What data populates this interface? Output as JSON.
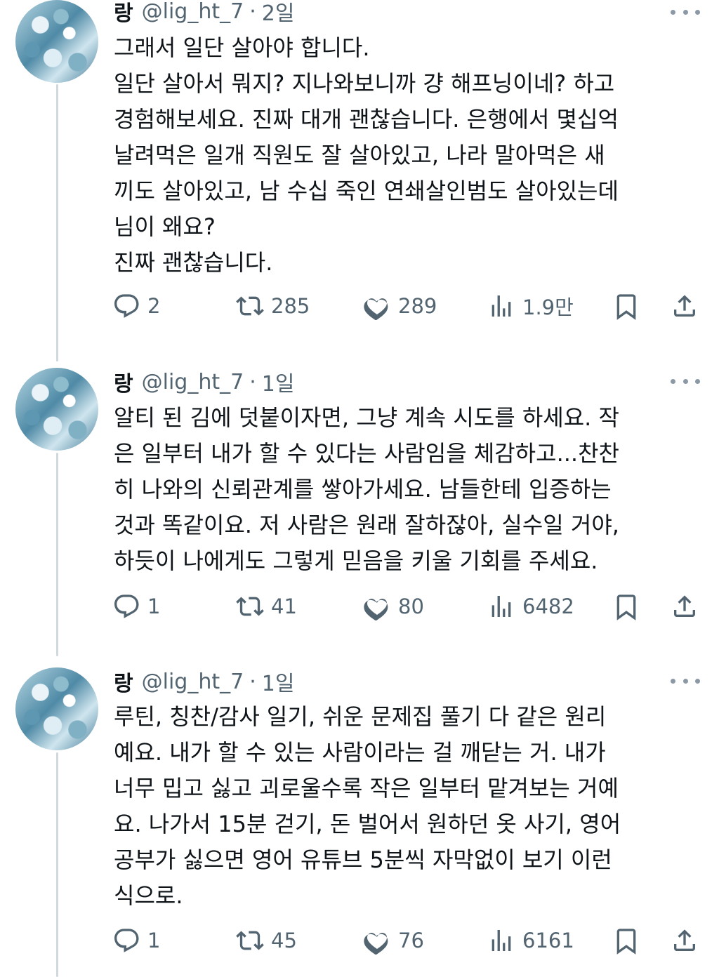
{
  "tweets": [
    {
      "name": "랑",
      "handle": "@lig_ht_7",
      "separator": "·",
      "time": "2일",
      "lines": [
        "그래서 일단 살아야 합니다.",
        "일단 살아서 뭐지? 지나와보니까 걍 해프닝이네? 하고",
        "경험해보세요. 진짜 대개 괜찮습니다. 은행에서 몇십억",
        "날려먹은 일개 직원도 잘 살아있고, 나라 말아먹은 새",
        "끼도 살아있고, 남 수십 죽인 연쇄살인범도 살아있는데",
        "님이 왜요?",
        "진짜 괜찮습니다."
      ],
      "replies": "2",
      "retweets": "285",
      "likes": "289",
      "views": "1.9만"
    },
    {
      "name": "랑",
      "handle": "@lig_ht_7",
      "separator": "·",
      "time": "1일",
      "lines": [
        "알티 된 김에 덧붙이자면, 그냥 계속 시도를 하세요. 작",
        "은 일부터 내가 할 수 있다는 사람임을 체감하고...찬찬",
        "히 나와의 신뢰관계를 쌓아가세요. 남들한테 입증하는",
        "것과 똑같이요. 저 사람은 원래 잘하잖아, 실수일 거야,",
        "하듯이 나에게도 그렇게 믿음을 키울 기회를 주세요."
      ],
      "replies": "1",
      "retweets": "41",
      "likes": "80",
      "views": "6482"
    },
    {
      "name": "랑",
      "handle": "@lig_ht_7",
      "separator": "·",
      "time": "1일",
      "lines": [
        "루틴, 칭찬/감사 일기, 쉬운 문제집 풀기 다 같은 원리",
        "예요. 내가 할 수 있는 사람이라는 걸 깨닫는 거. 내가",
        "너무 밉고 싫고 괴로울수록 작은 일부터 맡겨보는 거예",
        "요. 나가서 15분 걷기, 돈 벌어서 원하던 옷 사기, 영어",
        "공부가 싫으면 영어 유튜브 5분씩 자막없이 보기 이런",
        "식으로."
      ],
      "replies": "1",
      "retweets": "45",
      "likes": "76",
      "views": "6161"
    }
  ],
  "icons": [
    "reply-icon",
    "retweet-icon",
    "like-icon",
    "views-icon",
    "bookmark-icon",
    "share-icon",
    "more-icon"
  ],
  "colors": {
    "text": "#0f1419",
    "muted": "#536471",
    "thread_line": "#cfd9de"
  }
}
